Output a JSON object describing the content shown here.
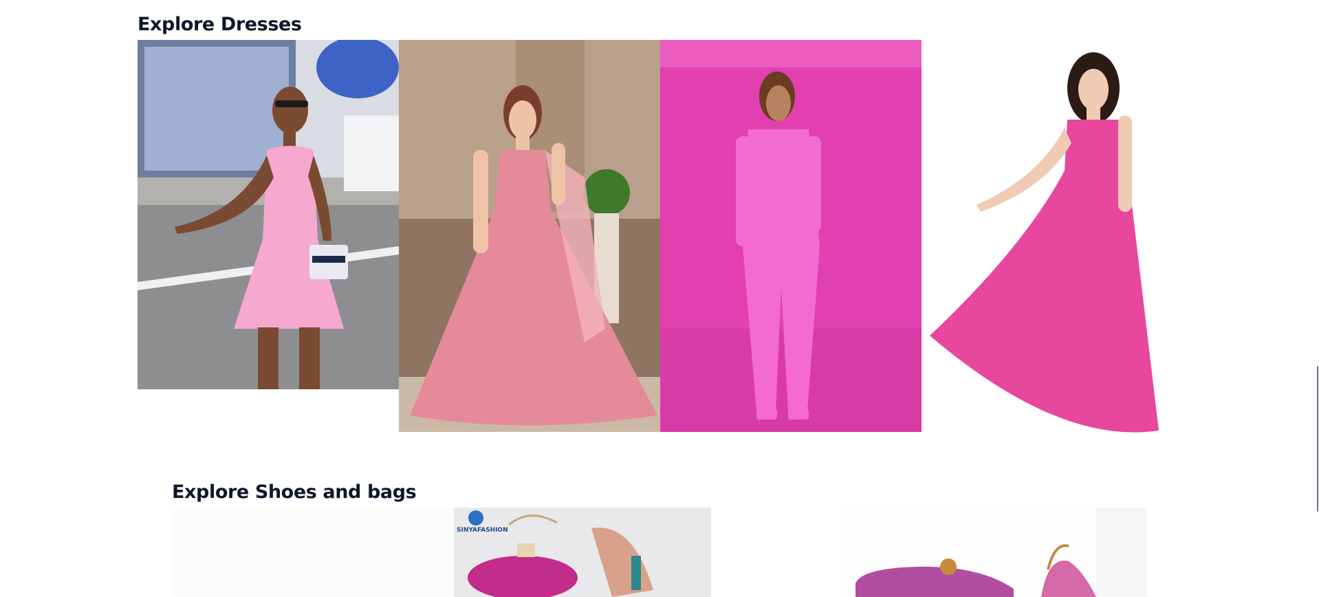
{
  "sections": {
    "dresses": {
      "title": "Explore Dresses",
      "images": [
        {
          "alt": "pink knit mini dress street style",
          "tint": "#f39ec8"
        },
        {
          "alt": "pink embroidered anarkali gown",
          "tint": "#e58a99"
        },
        {
          "alt": "hot pink floral suit on pink backdrop",
          "tint": "#ec3fb3"
        },
        {
          "alt": "pink flowing chiffon maxi gown",
          "tint": "#e7479d"
        }
      ]
    },
    "shoes_bags": {
      "title": "Explore Shoes and bags",
      "images": [
        {
          "alt": "white product photo"
        },
        {
          "alt": "pink jeweled clutch and heels set",
          "watermark": "SINYAFASHION"
        },
        {
          "alt": "white product photo"
        },
        {
          "alt": "pink clutch and sandal set"
        }
      ]
    }
  },
  "colors": {
    "heading": "#0f172a",
    "background": "#ffffff",
    "pink_backdrop": "#e23fb0",
    "pink_dress": "#f7a8cf"
  }
}
